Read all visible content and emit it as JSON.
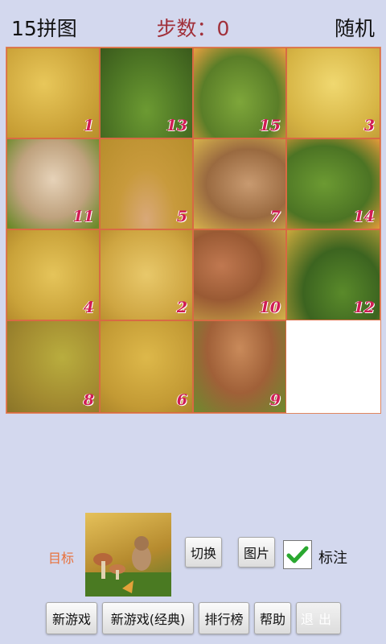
{
  "header": {
    "app_title": "15拼图",
    "steps_label": "步数：0",
    "random_label": "随机"
  },
  "board": {
    "tiles": [
      {
        "number": "1",
        "row": 0,
        "col": 0
      },
      {
        "number": "13",
        "row": 0,
        "col": 1
      },
      {
        "number": "15",
        "row": 0,
        "col": 2
      },
      {
        "number": "3",
        "row": 0,
        "col": 3
      },
      {
        "number": "11",
        "row": 1,
        "col": 0
      },
      {
        "number": "5",
        "row": 1,
        "col": 1
      },
      {
        "number": "7",
        "row": 1,
        "col": 2
      },
      {
        "number": "14",
        "row": 1,
        "col": 3
      },
      {
        "number": "4",
        "row": 2,
        "col": 0
      },
      {
        "number": "2",
        "row": 2,
        "col": 1
      },
      {
        "number": "10",
        "row": 2,
        "col": 2
      },
      {
        "number": "12",
        "row": 2,
        "col": 3
      },
      {
        "number": "8",
        "row": 3,
        "col": 0
      },
      {
        "number": "6",
        "row": 3,
        "col": 1
      },
      {
        "number": "9",
        "row": 3,
        "col": 2
      }
    ],
    "empty": {
      "row": 3,
      "col": 3
    }
  },
  "controls": {
    "goal_label": "目标",
    "switch_label": "切换",
    "picture_label": "图片",
    "mark_label": "标注",
    "mark_checked": true
  },
  "bottom": {
    "new_game": "新游戏",
    "new_game_classic": "新游戏(经典)",
    "leaderboard": "排行榜",
    "help": "帮助",
    "exit": "退出"
  },
  "colors": {
    "background": "#d3d8ee",
    "steps_text": "#a1303a",
    "tile_number": "#d01c55",
    "goal_label": "#e8703a",
    "check": "#2aa830"
  }
}
